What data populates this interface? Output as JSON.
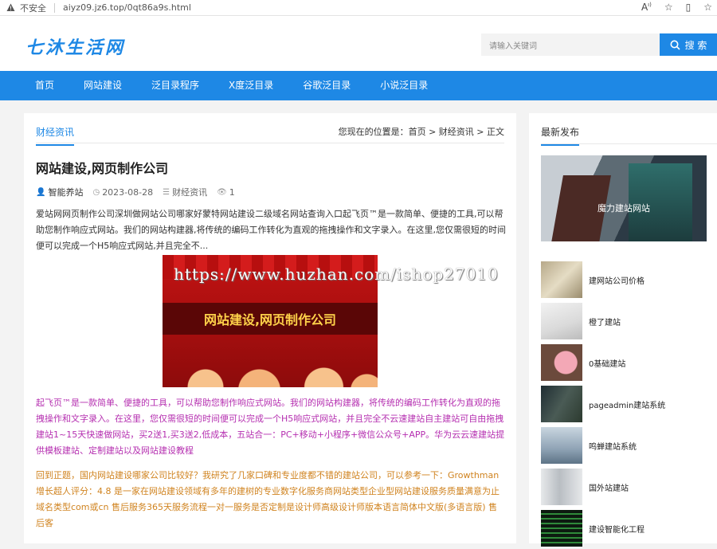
{
  "browser": {
    "insecure_label": "不安全",
    "url": "aiyz09.jz6.top/0qt86a9s.html"
  },
  "site": {
    "logo": "七沐生活网",
    "search_placeholder": "请输入关键词",
    "search_button": "搜 索"
  },
  "nav": [
    "首页",
    "网站建设",
    "泛目录程序",
    "X度泛目录",
    "谷歌泛目录",
    "小说泛目录"
  ],
  "breadcrumb": {
    "category_tab": "财经资讯",
    "location_prefix": "您现在的位置是：",
    "path": "首页 > 财经资讯 > 正文"
  },
  "article": {
    "title": "网站建设,网页制作公司",
    "author": "智能养站",
    "date": "2023-08-28",
    "category": "财经资讯",
    "views": "1",
    "intro": "爱站网网页制作公司深圳做网站公司哪家好蒙特网站建设二级域名网站查询入口起飞页™是一款简单、便捷的工具,可以帮助您制作响应式网站。我们的网站构建器,将传统的编码工作转化为直观的拖拽操作和文字录入。在这里,您仅需很短的时间便可以完成一个H5响应式网站,并且完全不...",
    "banner_text": "网站建设,网页制作公司",
    "watermark": "https://www.huzhan.com/ishop27010",
    "para_purple": "起飞页™是一款简单、便捷的工具，可以帮助您制作响应式网站。我们的网站构建器，将传统的编码工作转化为直观的拖拽操作和文字录入。在这里，您仅需很短的时间便可以完成一个H5响应式网站，并且完全不云速建站自主建站可自由拖拽建站1~15天快速做网站，买2送1,买3送2,低成本，五站合一：PC+移动+小程序+微信公众号+APP。华为云云速建站提供模板建站、定制建站以及网站建设教程",
    "para_orange": "回到正题，国内网站建设哪家公司比较好？我研究了几家口碑和专业度都不错的建站公司，可以参考一下：Growthman增长超人评分：4.8 是一家在网站建设领域有多年的建树的专业数字化服务商网站类型企业型网站建设服务质量满意为止域名类型com或cn 售后服务365天服务流程一对一服务是否定制是设计师高级设计师版本语言简体中文版(多语言版) 售后客"
  },
  "sidebar": {
    "heading": "最新发布",
    "featured": "魔力建站网站",
    "items": [
      "建网站公司价格",
      "橙了建站",
      "0基础建站",
      "pageadmin建站系统",
      "鸣蝉建站系统",
      "国外站建站",
      "建设智能化工程"
    ]
  },
  "colors": {
    "accent": "#1e88e5",
    "purple_text": "#b52fb0",
    "orange_text": "#d0831f"
  }
}
